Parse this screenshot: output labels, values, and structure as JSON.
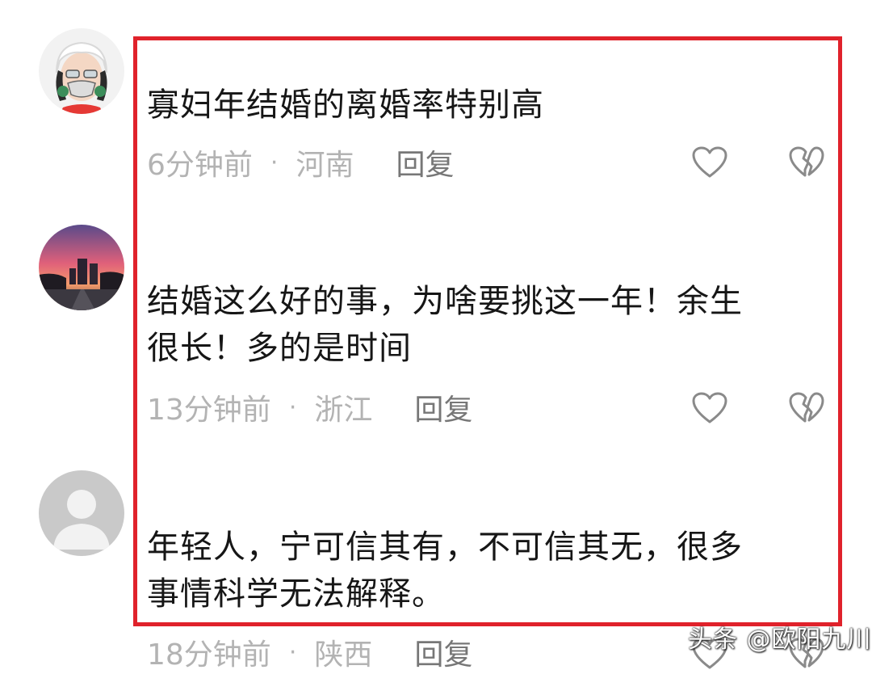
{
  "comments": [
    {
      "avatar": "avatar-cartoon-girl",
      "text": "寡妇年结婚的离婚率特别高",
      "time": "6分钟前",
      "location": "河南",
      "reply": "回复"
    },
    {
      "avatar": "avatar-sunset-city",
      "text_line1": "结婚这么好的事，为啥要挑这一年！余生",
      "text_line2": "很长！多的是时间",
      "time": "13分钟前",
      "location": "浙江",
      "reply": "回复"
    },
    {
      "avatar": "avatar-default-gray",
      "text_line1": "年轻人，宁可信其有，不可信其无，很多",
      "text_line2": "事情科学无法解释。",
      "time": "18分钟前",
      "location": "陕西",
      "reply": "回复"
    }
  ],
  "separator": "·",
  "icons": {
    "like": "heart-outline-icon",
    "dislike": "broken-heart-icon"
  },
  "highlight_color": "#e0222b",
  "watermark": "头条 @欧阳九川"
}
